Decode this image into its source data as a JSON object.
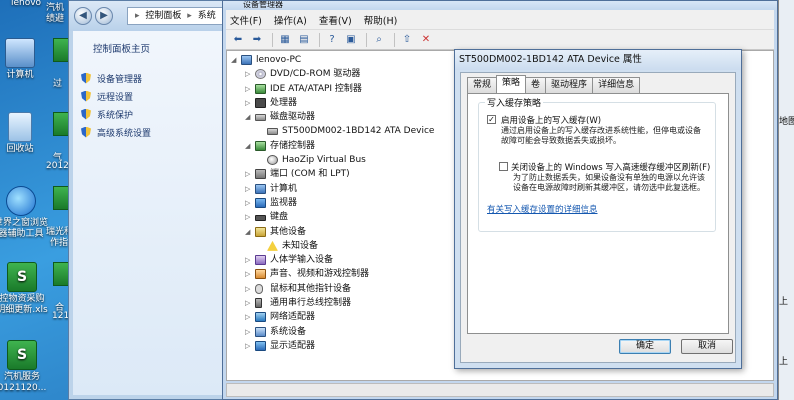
{
  "desktop": {
    "icons": [
      {
        "label": "lenovo",
        "label2": ""
      },
      {
        "label": "计算机",
        "label2": ""
      },
      {
        "label": "回收站",
        "label2": ""
      },
      {
        "label": "世界之窗浏览",
        "label2": "器辅助工具"
      },
      {
        "label": "控物资采购",
        "label2": "明细更新.xls"
      },
      {
        "label": "汽机服务",
        "label2": "0121120..."
      }
    ],
    "partials": [
      "汽机",
      "绩避",
      "过",
      "气",
      "2012",
      "瑞光种",
      "作指",
      "合",
      "121"
    ]
  },
  "control_panel": {
    "breadcrumb": [
      "控制面板",
      "系统"
    ],
    "home_label": "控制面板主页",
    "links": [
      "设备管理器",
      "远程设置",
      "系统保护",
      "高级系统设置"
    ]
  },
  "device_manager": {
    "title": "设备管理器",
    "menu": [
      "文件(F)",
      "操作(A)",
      "查看(V)",
      "帮助(H)"
    ],
    "tree": [
      {
        "label": "lenovo-PC",
        "level": 0,
        "expander": "◢",
        "icon": "computer-icon"
      },
      {
        "label": "DVD/CD-ROM 驱动器",
        "level": 1,
        "expander": "▷",
        "icon": "dvd-drive-icon"
      },
      {
        "label": "IDE ATA/ATAPI 控制器",
        "level": 1,
        "expander": "▷",
        "icon": "ide-controller-icon"
      },
      {
        "label": "处理器",
        "level": 1,
        "expander": "▷",
        "icon": "processor-icon"
      },
      {
        "label": "磁盘驱动器",
        "level": 1,
        "expander": "◢",
        "icon": "disk-drive-icon"
      },
      {
        "label": "ST500DM002-1BD142 ATA Device",
        "level": 2,
        "expander": "",
        "icon": "disk-drive-icon"
      },
      {
        "label": "存储控制器",
        "level": 1,
        "expander": "◢",
        "icon": "storage-controller-icon"
      },
      {
        "label": "HaoZip Virtual Bus",
        "level": 2,
        "expander": "",
        "icon": "virtual-bus-icon"
      },
      {
        "label": "端口 (COM 和 LPT)",
        "level": 1,
        "expander": "▷",
        "icon": "port-icon"
      },
      {
        "label": "计算机",
        "level": 1,
        "expander": "▷",
        "icon": "computer-icon"
      },
      {
        "label": "监视器",
        "level": 1,
        "expander": "▷",
        "icon": "monitor-icon"
      },
      {
        "label": "键盘",
        "level": 1,
        "expander": "▷",
        "icon": "keyboard-icon"
      },
      {
        "label": "其他设备",
        "level": 1,
        "expander": "◢",
        "icon": "other-devices-icon"
      },
      {
        "label": "未知设备",
        "level": 2,
        "expander": "",
        "icon": "unknown-device-warning-icon"
      },
      {
        "label": "人体学输入设备",
        "level": 1,
        "expander": "▷",
        "icon": "hid-icon"
      },
      {
        "label": "声音、视频和游戏控制器",
        "level": 1,
        "expander": "▷",
        "icon": "sound-icon"
      },
      {
        "label": "鼠标和其他指针设备",
        "level": 1,
        "expander": "▷",
        "icon": "mouse-icon"
      },
      {
        "label": "通用串行总线控制器",
        "level": 1,
        "expander": "▷",
        "icon": "usb-icon"
      },
      {
        "label": "网络适配器",
        "level": 1,
        "expander": "▷",
        "icon": "network-adapter-icon"
      },
      {
        "label": "系统设备",
        "level": 1,
        "expander": "▷",
        "icon": "system-device-icon"
      },
      {
        "label": "显示适配器",
        "level": 1,
        "expander": "▷",
        "icon": "display-adapter-icon"
      }
    ]
  },
  "properties_dialog": {
    "title": "ST500DM002-1BD142 ATA Device 属性",
    "tabs": [
      "常规",
      "策略",
      "卷",
      "驱动程序",
      "详细信息"
    ],
    "active_tab": "策略",
    "group_title": "写入缓存策略",
    "option1": {
      "label": "启用设备上的写入缓存(W)",
      "checked": true,
      "desc_line1": "通过启用设备上的写入缓存改进系统性能，但停电或设备",
      "desc_line2": "故障可能会导致数据丢失或损坏。"
    },
    "option2": {
      "label": "关闭设备上的 Windows 写入高速缓存缓冲区刷新(F)",
      "checked": false,
      "desc_line1": "为了防止数据丢失，如果设备没有单独的电源以允许该",
      "desc_line2": "设备在电源故障时刷新其缓冲区，请勿选中此复选框。"
    },
    "link": "有关写入缓存设置的详细信息",
    "ok_label": "确定",
    "cancel_label": "取消"
  },
  "right_window": {
    "fragments": [
      "地图",
      "上",
      "上"
    ]
  }
}
